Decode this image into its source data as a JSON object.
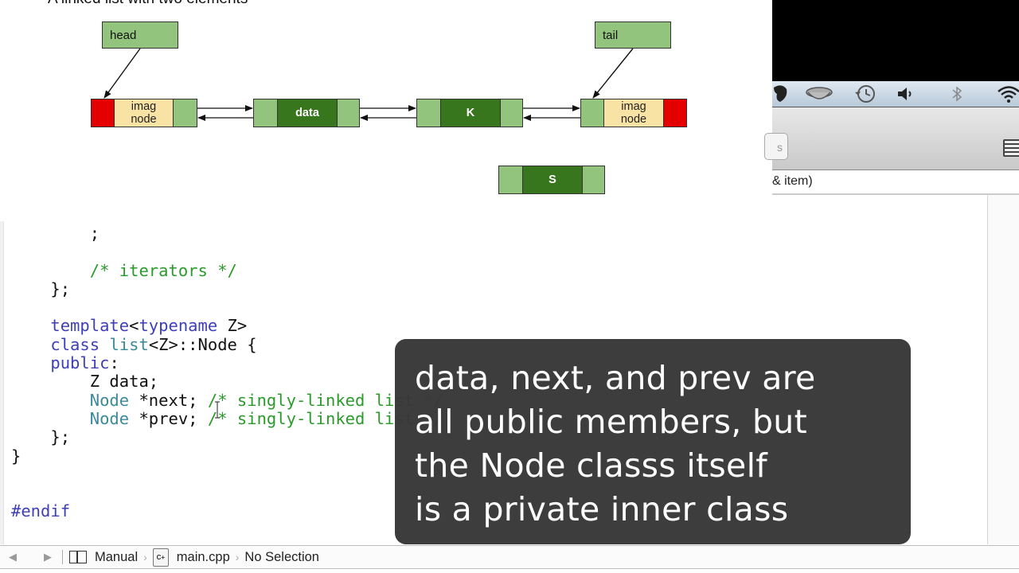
{
  "slide": {
    "title": "A linked list with two elements",
    "labels": {
      "head": "head",
      "tail": "tail"
    },
    "nodes": {
      "head_node": {
        "cells": [
          "",
          "imag\nnode",
          ""
        ]
      },
      "data_node": {
        "cells": [
          "",
          "data",
          ""
        ]
      },
      "k_node": {
        "cells": [
          "",
          "K",
          ""
        ]
      },
      "tail_node": {
        "cells": [
          "",
          "imag\nnode",
          ""
        ]
      },
      "s_node": {
        "cells": [
          "",
          "S",
          ""
        ]
      }
    },
    "colors": {
      "sentinel_red": "#e50000",
      "pointer_green": "#93c47d",
      "data_green": "#38761d",
      "imag_yellow": "#f9e3a4"
    }
  },
  "code": {
    "lines": [
      [
        {
          "t": "        ;",
          "c": "pl"
        }
      ],
      [
        {
          "t": "",
          "c": "pl"
        }
      ],
      [
        {
          "t": "        ",
          "c": "pl"
        },
        {
          "t": "/* iterators */",
          "c": "cm"
        }
      ],
      [
        {
          "t": "    };",
          "c": "pl"
        }
      ],
      [
        {
          "t": "",
          "c": "pl"
        }
      ],
      [
        {
          "t": "    ",
          "c": "pl"
        },
        {
          "t": "template",
          "c": "kw"
        },
        {
          "t": "<",
          "c": "pl"
        },
        {
          "t": "typename",
          "c": "kw"
        },
        {
          "t": " Z>",
          "c": "pl"
        }
      ],
      [
        {
          "t": "    ",
          "c": "pl"
        },
        {
          "t": "class",
          "c": "kw"
        },
        {
          "t": " ",
          "c": "pl"
        },
        {
          "t": "list",
          "c": "ty"
        },
        {
          "t": "<Z>::Node {",
          "c": "pl"
        }
      ],
      [
        {
          "t": "    ",
          "c": "pl"
        },
        {
          "t": "public",
          "c": "kw"
        },
        {
          "t": ":",
          "c": "pl"
        }
      ],
      [
        {
          "t": "        Z data;",
          "c": "pl"
        }
      ],
      [
        {
          "t": "        ",
          "c": "pl"
        },
        {
          "t": "Node",
          "c": "ty"
        },
        {
          "t": " *next; ",
          "c": "pl"
        },
        {
          "t": "/* singly-linked list */",
          "c": "cm"
        }
      ],
      [
        {
          "t": "        ",
          "c": "pl"
        },
        {
          "t": "Node",
          "c": "ty"
        },
        {
          "t": " *prev; ",
          "c": "pl"
        },
        {
          "t": "/* singly-linked list */",
          "c": "cm"
        }
      ],
      [
        {
          "t": "    };",
          "c": "pl"
        }
      ],
      [
        {
          "t": "}",
          "c": "pl"
        }
      ],
      [
        {
          "t": "",
          "c": "pl"
        }
      ],
      [
        {
          "t": "",
          "c": "pl"
        }
      ],
      [
        {
          "t": "#endif",
          "c": "pp"
        }
      ]
    ]
  },
  "menubar": {
    "icons": [
      "evernote-icon",
      "coffee-cup-icon",
      "time-machine-icon",
      "volume-icon",
      "bluetooth-icon",
      "wifi-icon"
    ]
  },
  "toolbar": {
    "partial_button_label": "s"
  },
  "doc_header": {
    "partial_text": "& item)"
  },
  "caption": {
    "lines": [
      "data, next, and prev are",
      "all public members, but",
      "the Node classs itself",
      "is a private inner class"
    ]
  },
  "jumpbar": {
    "back": "◀",
    "forward": "▶",
    "group": "Manual",
    "file": "main.cpp",
    "file_icon_text": "C+",
    "selection": "No Selection"
  }
}
